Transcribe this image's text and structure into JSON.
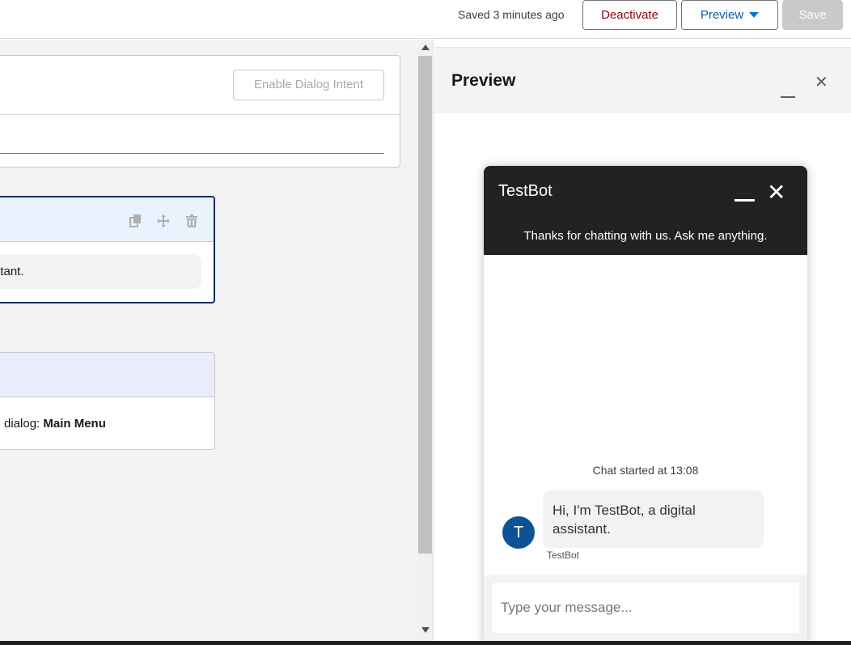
{
  "toolbar": {
    "saved_status": "Saved 3 minutes ago",
    "deactivate_label": "Deactivate",
    "preview_label": "Preview",
    "save_label": "Save"
  },
  "builder": {
    "enable_dialog_intent_label": "Enable Dialog Intent",
    "message_text": "sistant.",
    "redirect_prefix": "dialog: ",
    "redirect_target": "Main Menu",
    "icons": [
      "copy-icon",
      "move-icon",
      "delete-icon"
    ]
  },
  "preview_panel": {
    "title": "Preview"
  },
  "chat": {
    "bot_name": "TestBot",
    "greeting": "Thanks for chatting with us. Ask me anything.",
    "started_text": "Chat started at 13:08",
    "avatar_letter": "T",
    "bot_message": "Hi, I'm TestBot, a digital assistant.",
    "bot_label": "TestBot",
    "input_placeholder": "Type your message..."
  },
  "colors": {
    "accent": "#0176d3",
    "destructive": "#8e030f",
    "chat_header": "#222222",
    "avatar": "#0b5394"
  }
}
